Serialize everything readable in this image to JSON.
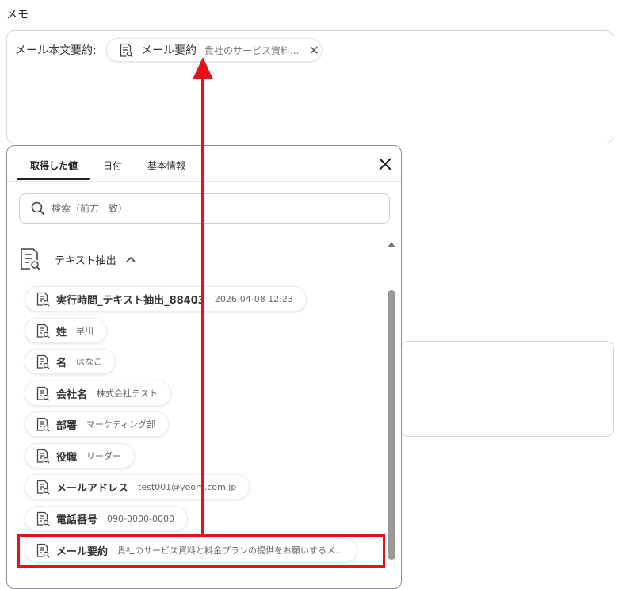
{
  "memo": {
    "label": "メモ",
    "prefix": "メール本文要約:",
    "chip": {
      "name": "メール要約",
      "value": "貴社のサービス資料..."
    }
  },
  "panel": {
    "tabs": [
      {
        "label": "取得した値",
        "active": true
      },
      {
        "label": "日付",
        "active": false
      },
      {
        "label": "基本情報",
        "active": false
      }
    ],
    "search": {
      "placeholder": "検索（前方一致）",
      "value": ""
    },
    "group": {
      "name": "テキスト抽出",
      "expanded": true,
      "items": [
        {
          "name": "実行時間_テキスト抽出_88403",
          "value": "2026-04-08 12:23"
        },
        {
          "name": "姓",
          "value": "早川"
        },
        {
          "name": "名",
          "value": "はなこ"
        },
        {
          "name": "会社名",
          "value": "株式会社テスト"
        },
        {
          "name": "部署",
          "value": "マーケティング部"
        },
        {
          "name": "役職",
          "value": "リーダー"
        },
        {
          "name": "メールアドレス",
          "value": "test001@yoom.com.jp"
        },
        {
          "name": "電話番号",
          "value": "090-0000-0000"
        },
        {
          "name": "メール要約",
          "value": "貴社のサービス資料と料金プランの提供をお願いするメ..."
        }
      ]
    }
  },
  "annotation": {
    "color": "#e0151b"
  },
  "icons": {
    "variable": "document-search-icon",
    "close": "close-icon",
    "search": "search-icon",
    "chevron": "chevron-up-icon"
  }
}
